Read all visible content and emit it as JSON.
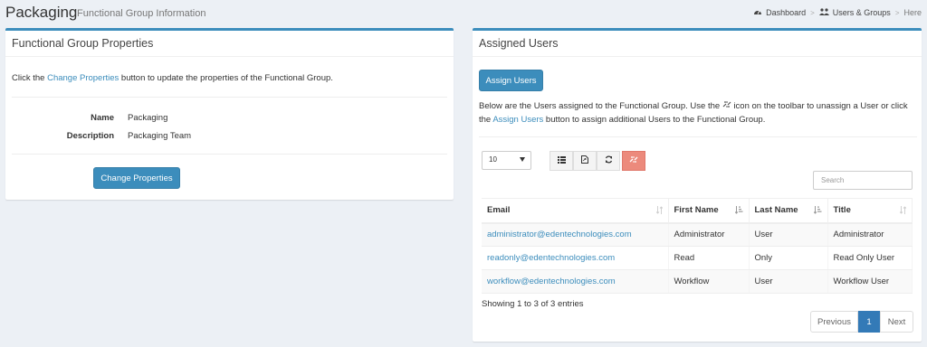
{
  "header": {
    "title": "Packaging",
    "subtitle": "Functional Group Information",
    "breadcrumb": [
      {
        "label": "Dashboard",
        "icon": "dashboard-icon"
      },
      {
        "label": "Users & Groups",
        "icon": "users-icon"
      },
      {
        "label": "Here"
      }
    ]
  },
  "properties_box": {
    "title": "Functional Group Properties",
    "intro_before": "Click the ",
    "intro_link": "Change Properties",
    "intro_after": " button to update the properties of the Functional Group.",
    "fields": [
      {
        "label": "Name",
        "value": "Packaging"
      },
      {
        "label": "Description",
        "value": "Packaging Team"
      }
    ],
    "button_label": "Change Properties"
  },
  "users_box": {
    "title": "Assigned Users",
    "assign_button_label": "Assign Users",
    "desc_before": "Below are the Users assigned to the Functional Group. Use the ",
    "desc_middle": " icon on the toolbar to unassign a User or click the ",
    "desc_link": "Assign Users",
    "desc_after": " button to assign additional Users to the Functional Group.",
    "page_size": "10",
    "toolbar": [
      {
        "icon": "list-icon"
      },
      {
        "icon": "export-icon"
      },
      {
        "icon": "refresh-icon"
      },
      {
        "icon": "unassign-icon",
        "color": "#ec8a7c"
      }
    ],
    "search_placeholder": "Search",
    "columns": [
      "Email",
      "First Name",
      "Last Name",
      "Title"
    ],
    "rows": [
      {
        "email": "administrator@edentechnologies.com",
        "first": "Administrator",
        "last": "User",
        "title": "Administrator"
      },
      {
        "email": "readonly@edentechnologies.com",
        "first": "Read",
        "last": "Only",
        "title": "Read Only User"
      },
      {
        "email": "workflow@edentechnologies.com",
        "first": "Workflow",
        "last": "User",
        "title": "Workflow User"
      }
    ],
    "info": "Showing 1 to 3 of 3 entries",
    "pagination": {
      "previous": "Previous",
      "current": "1",
      "next": "Next"
    }
  },
  "colors": {
    "accent": "#3c8dbc",
    "danger": "#ec8a7c",
    "background": "#ecf0f5"
  }
}
